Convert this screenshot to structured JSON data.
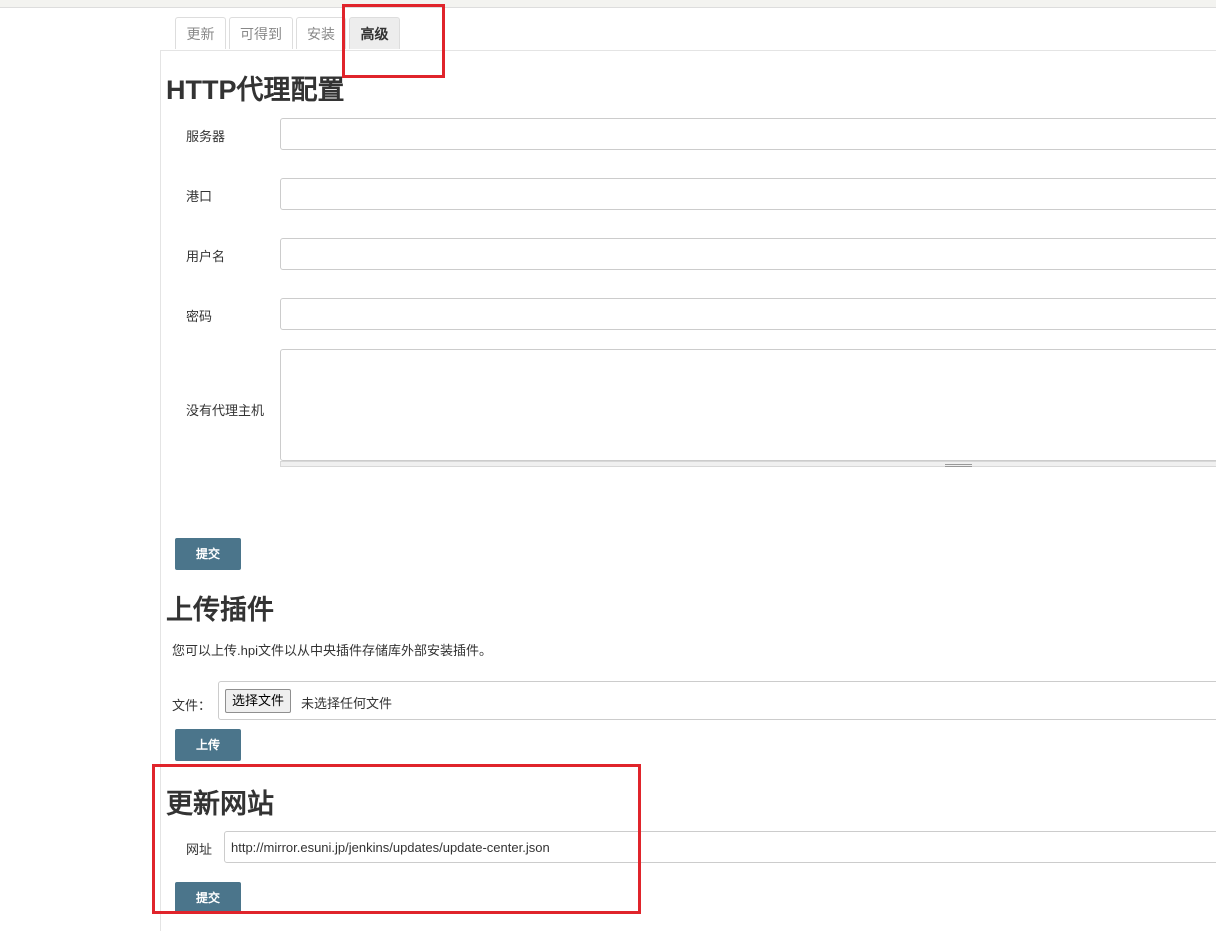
{
  "tabs": [
    {
      "label": "更新"
    },
    {
      "label": "可得到"
    },
    {
      "label": "安装"
    },
    {
      "label": "高级",
      "active": true
    }
  ],
  "proxy": {
    "title": "HTTP代理配置",
    "server_label": "服务器",
    "server_value": "",
    "port_label": "港口",
    "port_value": "",
    "username_label": "用户名",
    "username_value": "",
    "password_label": "密码",
    "password_value": "",
    "no_proxy_label": "没有代理主机",
    "no_proxy_value": "",
    "submit_label": "提交"
  },
  "upload": {
    "title": "上传插件",
    "description": "您可以上传.hpi文件以从中央插件存储库外部安装插件。",
    "file_label": "文件：",
    "choose_file_label": "选择文件",
    "no_file_text": "未选择任何文件",
    "upload_label": "上传"
  },
  "update_site": {
    "title": "更新网站",
    "url_label": "网址",
    "url_value": "http://mirror.esuni.jp/jenkins/updates/update-center.json",
    "submit_label": "提交"
  },
  "colors": {
    "button": "#4b758b",
    "highlight": "#e0242b"
  }
}
